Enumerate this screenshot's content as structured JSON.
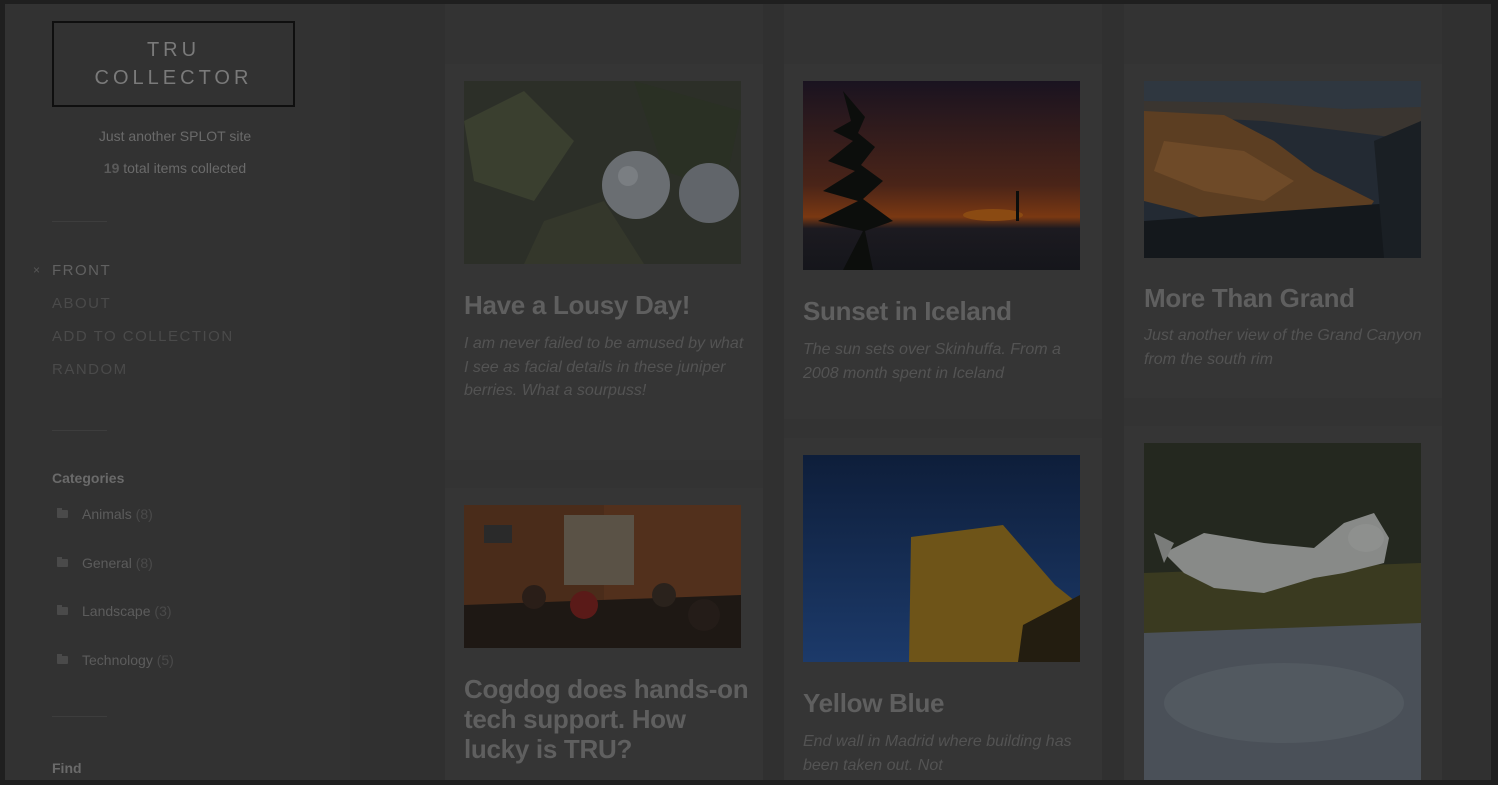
{
  "site": {
    "title_line1": "TRU",
    "title_line2": "COLLECTOR",
    "tagline": "Just another SPLOT site",
    "total_count": "19",
    "total_label": " total items collected"
  },
  "nav": {
    "current_marker": "×",
    "items": [
      {
        "label": "FRONT"
      },
      {
        "label": "ABOUT"
      },
      {
        "label": "ADD TO COLLECTION"
      },
      {
        "label": "RANDOM"
      }
    ]
  },
  "categories": {
    "title": "Categories",
    "items": [
      {
        "name": "Animals",
        "count": " (8)"
      },
      {
        "name": "General",
        "count": " (8)"
      },
      {
        "name": "Landscape",
        "count": " (3)"
      },
      {
        "name": "Technology",
        "count": " (5)"
      }
    ]
  },
  "find": {
    "title": "Find"
  },
  "posts": [
    {
      "title": "Have a Lousy Day!",
      "excerpt": "I am never failed to be amused by what I see as facial details in these juniper berries. What a sourpuss!"
    },
    {
      "title": "Sunset in Iceland",
      "excerpt": "The sun sets over Skinhuffa. From a 2008 month spent in Iceland"
    },
    {
      "title": "More Than Grand",
      "excerpt": "Just another view of the Grand Canyon from the south rim"
    },
    {
      "title": "Cogdog does hands-on tech support. How lucky is TRU?",
      "excerpt": ""
    },
    {
      "title": "Yellow Blue",
      "excerpt": "End wall in Madrid where building has been taken out. Not"
    },
    {
      "title": "",
      "excerpt": ""
    }
  ]
}
